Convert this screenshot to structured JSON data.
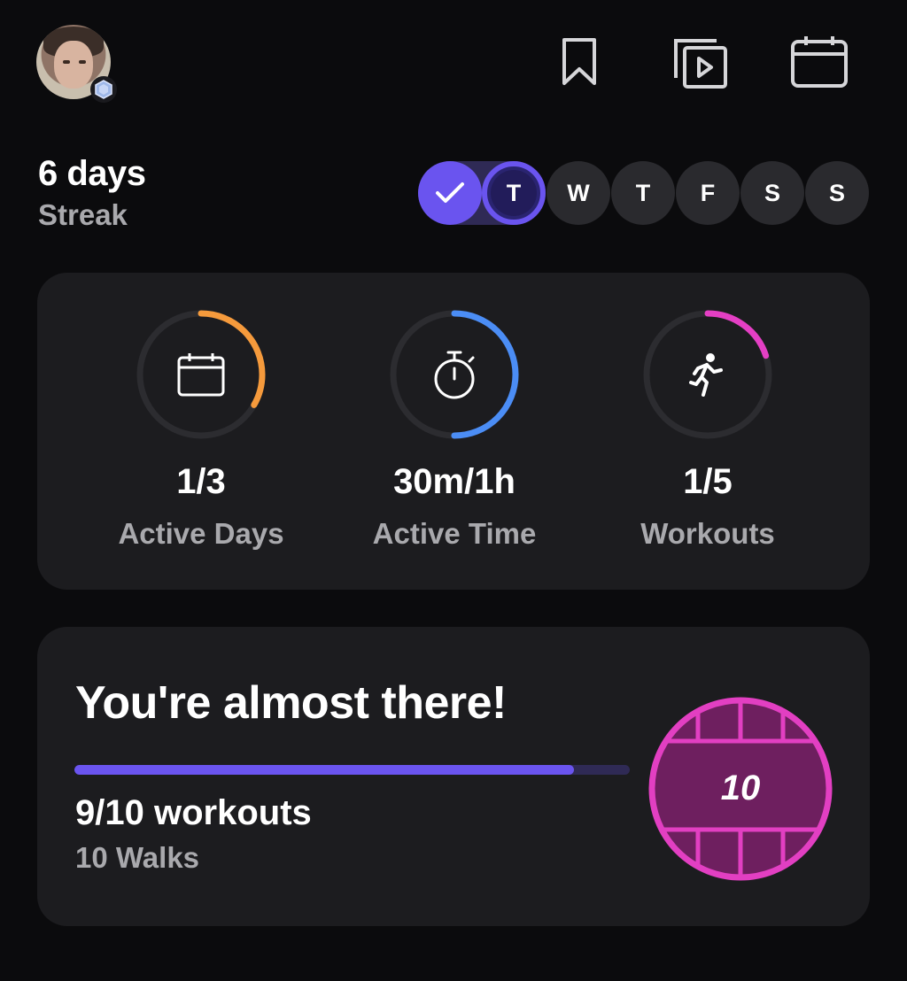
{
  "header": {
    "avatar_alt": "Profile photo",
    "icons": [
      "bookmark-icon",
      "video-library-icon",
      "calendar-icon"
    ]
  },
  "streak": {
    "value": "6 days",
    "label": "Streak"
  },
  "week": {
    "days": [
      {
        "label": "✓",
        "state": "done"
      },
      {
        "label": "T",
        "state": "today"
      },
      {
        "label": "W",
        "state": "upcoming"
      },
      {
        "label": "T",
        "state": "upcoming"
      },
      {
        "label": "F",
        "state": "upcoming"
      },
      {
        "label": "S",
        "state": "upcoming"
      },
      {
        "label": "S",
        "state": "upcoming"
      }
    ]
  },
  "stats": [
    {
      "value": "1/3",
      "label": "Active Days",
      "icon": "calendar-icon",
      "progress": 0.333,
      "color": "#f59a3c"
    },
    {
      "value": "30m/1h",
      "label": "Active Time",
      "icon": "stopwatch-icon",
      "progress": 0.5,
      "color": "#4b8df5"
    },
    {
      "value": "1/5",
      "label": "Workouts",
      "icon": "running-person-icon",
      "progress": 0.2,
      "color": "#e43fc4"
    }
  ],
  "challenge": {
    "title": "You're almost there!",
    "progress": 0.9,
    "count": "9/10 workouts",
    "subtitle": "10 Walks",
    "medal_number": "10",
    "medal_color": "#e23fc2",
    "medal_fill": "#6e1f5f"
  },
  "colors": {
    "accent": "#6a54ef",
    "card": "#1c1c1f",
    "background": "#0b0b0d"
  }
}
